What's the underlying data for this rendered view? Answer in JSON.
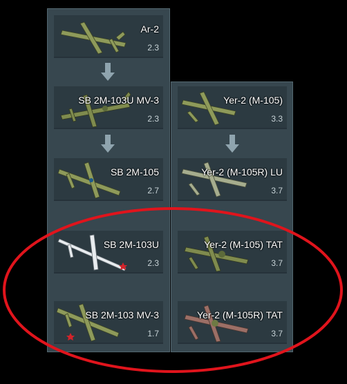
{
  "columns": {
    "left": [
      {
        "name": "Ar-2",
        "br": "2.3",
        "icon": "plane-green-icon"
      },
      {
        "name": "SB 2M-103U MV-3",
        "br": "2.3",
        "icon": "plane-camo-icon"
      },
      {
        "name": "SB 2M-105",
        "br": "2.7",
        "icon": "plane-green-icon"
      },
      {
        "name": "SB 2M-103U",
        "br": "2.3",
        "icon": "plane-white-icon"
      },
      {
        "name": "SB 2M-103 MV-3",
        "br": "1.7",
        "icon": "plane-green-icon"
      }
    ],
    "right": [
      {
        "name": "Yer-2 (M-105)",
        "br": "3.3",
        "icon": "plane-green-icon"
      },
      {
        "name": "Yer-2 (M-105R) LU",
        "br": "3.7",
        "icon": "plane-grey-icon"
      },
      {
        "name": "Yer-2 (M-105) TAT",
        "br": "3.7",
        "icon": "plane-camo-icon"
      },
      {
        "name": "Yer-2 (M-105R) TAT",
        "br": "3.7",
        "icon": "plane-pink-camo-icon"
      }
    ]
  },
  "colors": {
    "panel": "#37474f",
    "card": "#2c3a41",
    "arrow": "#8fa4ae",
    "highlight_ring": "#e0141c",
    "plane_green": "#8e9a5a",
    "plane_white": "#e8ecef",
    "plane_grey": "#a6ad8e",
    "plane_camo": "#7f8b4e",
    "plane_pink_camo": "#9c6f66"
  }
}
